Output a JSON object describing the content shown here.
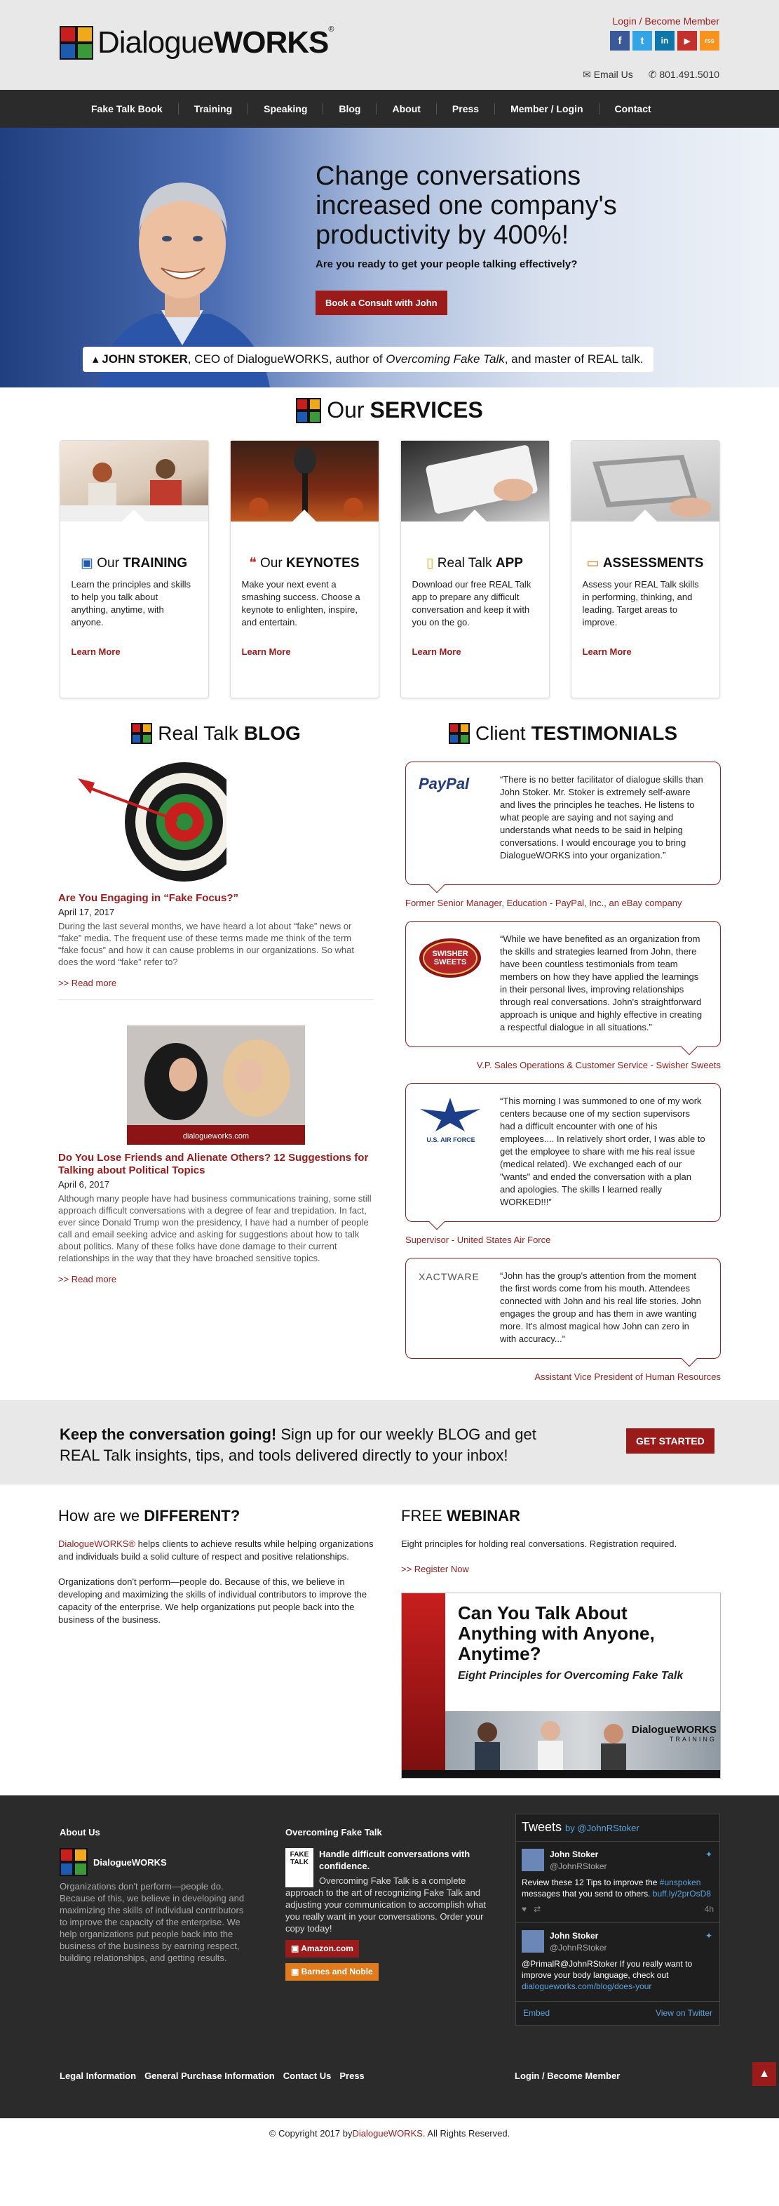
{
  "header": {
    "logo_word_light": "Dialogue",
    "logo_word_bold": "WORKS",
    "logo_reg": "®",
    "login_link": "Login / Become Member",
    "social": [
      "f",
      "t",
      "in",
      "▶",
      "rss"
    ],
    "email_label": "Email Us",
    "phone": "801.491.5010"
  },
  "nav": [
    "Fake Talk Book",
    "Training",
    "Speaking",
    "Blog",
    "About",
    "Press",
    "Member / Login",
    "Contact"
  ],
  "hero": {
    "headline": "Change conversations increased one company's productivity by 400%!",
    "subhead": "Are you ready to get your people talking effectively?",
    "button": "Book a Consult with John",
    "caption_name": "JOHN STOKER",
    "caption_mid": ", CEO of DialogueWORKS, author of ",
    "caption_book": "Overcoming Fake Talk",
    "caption_end": ", and master of REAL talk."
  },
  "services": {
    "title_light": "Our",
    "title_bold": "SERVICES",
    "cards": [
      {
        "light": "Our",
        "bold": "TRAINING",
        "text": "Learn the principles and skills to help you talk about anything, anytime, with anyone.",
        "more": "Learn More"
      },
      {
        "light": "Our",
        "bold": "KEYNOTES",
        "text": "Make your next event a smashing success. Choose a keynote to enlighten, inspire, and entertain.",
        "more": "Learn More"
      },
      {
        "light": "Real Talk",
        "bold": "APP",
        "text": "Download our free REAL Talk app to prepare any difficult conversation and keep it with you on the go.",
        "more": "Learn More"
      },
      {
        "light": "",
        "bold": "ASSESSMENTS",
        "text": "Assess your REAL Talk skills in performing, thinking, and leading. Target areas to improve.",
        "more": "Learn More"
      }
    ]
  },
  "blog": {
    "title_light": "Real Talk",
    "title_bold": "BLOG",
    "posts": [
      {
        "title": "Are You Engaging in “Fake Focus?”",
        "date": "April 17, 2017",
        "body": "During the last several months, we have heard a lot about “fake” news or “fake” media. The frequent use of these terms made me think of the term “fake focus” and how it can cause problems in our organizations. So what does the word “fake” refer to?",
        "more": ">> Read more"
      },
      {
        "title": "Do You Lose Friends and Alienate Others? 12 Suggestions for Talking about Political Topics",
        "date": "April 6, 2017",
        "body": "Although many people have had business communications training, some still approach difficult conversations with a degree of fear and trepidation. In fact, ever since Donald Trump won the presidency, I have had a number of people call and email seeking advice and asking for suggestions about how to talk about politics. Many of these folks have done damage to their current relationships in the way that they have broached sensitive topics.",
        "more": ">> Read more",
        "image_caption": "dialogueworks.com"
      }
    ]
  },
  "testimonials": {
    "title_light": "Client",
    "title_bold": "TESTIMONIALS",
    "items": [
      {
        "logo": "PayPal",
        "quote": "“There is no better facilitator of dialogue skills than John Stoker. Mr. Stoker is extremely self-aware and lives the principles he teaches. He listens to what people are saying and not saying and understands what needs to be said in helping conversations. I would encourage you to bring DialogueWORKS into your organization.”",
        "who": "Former Senior Manager, Education - PayPal, Inc., an eBay company"
      },
      {
        "logo": "SWISHER SWEETS",
        "quote": "“While we have benefited as an organization from the skills and strategies learned from John, there have been countless testimonials from team members on how they have applied the learnings in their personal lives, improving relationships through real conversations. John's straightforward approach is unique and highly effective in creating a respectful dialogue in all situations.”",
        "who": "V.P. Sales Operations & Customer Service - Swisher Sweets"
      },
      {
        "logo": "U.S. AIR FORCE",
        "quote": "“This morning I was summoned to one of my work centers because one of my section supervisors had a difficult encounter with one of his employees.... In relatively short order, I was able to get the employee to share with me his real issue (medical related). We exchanged each of our \"wants\" and ended the conversation with a plan and apologies. The skills I learned really WORKED!!!”",
        "who": "Supervisor - United States Air Force"
      },
      {
        "logo": "XACTWARE",
        "quote": "“John has the group's attention from the moment the first words come from his mouth. Attendees connected with John and his real life stories. John engages the group and has them in awe wanting more. It's almost magical how John can zero in with accuracy...”",
        "who": "Assistant Vice President of Human Resources"
      }
    ]
  },
  "cta": {
    "bold": "Keep the conversation going!",
    "text": " Sign up for our weekly BLOG and get REAL Talk insights, tips, and tools delivered directly to your inbox!",
    "button": "GET STARTED"
  },
  "different": {
    "title_light": "How are we",
    "title_bold": "DIFFERENT?",
    "p1_red": "DialogueWORKS®",
    "p1": " helps clients to achieve results while helping organizations and individuals build a solid culture of respect and positive relationships.",
    "p2": "Organizations don't perform—people do. Because of this, we believe in developing and maximizing the skills of individual contributors to improve the capacity of the enterprise. We help organizations put people back into the business of the business."
  },
  "webinar": {
    "title_light": "FREE",
    "title_bold": "WEBINAR",
    "text": "Eight principles for holding real conversations. Registration required.",
    "link": ">> Register Now",
    "video_title": "Can You Talk About Anything with Anyone, Anytime?",
    "video_sub": "Eight Principles for Overcoming Fake Talk",
    "video_brand": "DialogueWORKS",
    "video_brand_sub": "TRAINING"
  },
  "footer": {
    "about_h": "About Us",
    "about_logo": "DialogueWORKS",
    "about_text": "Organizations don't perform—people do. Because of this, we believe in developing and maximizing the skills of individual contributors to improve the capacity of the enterprise. We help organizations put people back into the business of the business by earning respect, building relationships, and getting results.",
    "book_h": "Overcoming Fake Talk",
    "book_bold": "Handle difficult conversations with confidence.",
    "book_text": "Overcoming Fake Talk is a complete approach to the art of recognizing Fake Talk and adjusting your communication to accomplish what you really want in your conversations. Order your copy today!",
    "book_cover": "FAKE TALK",
    "btn_amazon": "Amazon.com",
    "btn_bn": "Barnes and Noble",
    "tweets_h": "Tweets",
    "tweets_by": "by @JohnRStoker",
    "tweets": [
      {
        "name": "John Stoker",
        "handle": "@JohnRStoker",
        "text": "Review these 12 Tips to improve the ",
        "tag": "#unspoken",
        "text2": " messages that you send to others. ",
        "link": "buff.ly/2prOsD8",
        "time": "4h"
      },
      {
        "name": "John Stoker",
        "handle": "@JohnRStoker",
        "text": "@PrimalR@JohnRStoker If you really want to improve your body language, check out ",
        "link": "dialogueworks.com/blog/does-your"
      }
    ],
    "tw_embed": "Embed",
    "tw_view": "View on Twitter",
    "links": [
      "Legal Information",
      "General Purchase Information",
      "Contact Us",
      "Press"
    ],
    "login": "Login / Become Member",
    "up": "▲",
    "copy_pre": "© Copyright 2017 by ",
    "copy_brand": "DialogueWORKS",
    "copy_post": ". All Rights Reserved."
  },
  "colors": {
    "accent": "#9b1b1b",
    "nav": "#2b2b2b",
    "twitter": "#5ba4e0"
  }
}
